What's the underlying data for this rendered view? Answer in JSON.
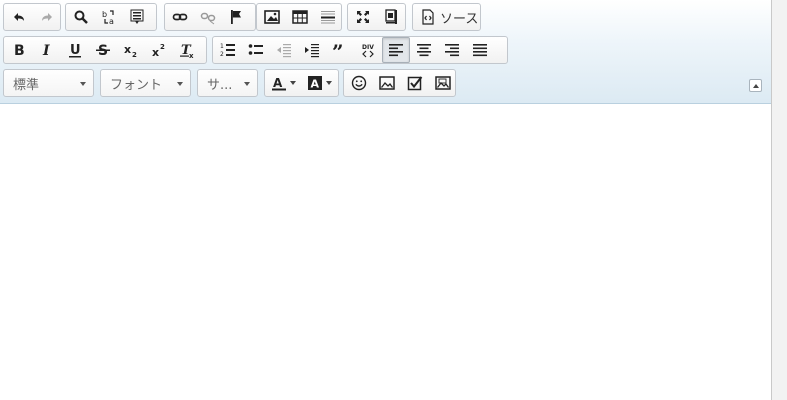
{
  "toolbar": {
    "source_label": "ソース",
    "format_placeholder": "標準",
    "font_placeholder": "フォント",
    "size_placeholder": "サ..."
  },
  "icons": {
    "row1": [
      "undo-icon",
      "redo-icon",
      "find-icon",
      "replace-icon",
      "select-all-icon",
      "link-icon",
      "unlink-icon",
      "anchor-icon",
      "image-icon",
      "table-icon",
      "horizontal-rule-icon",
      "maximize-icon",
      "show-blocks-icon",
      "source-icon"
    ],
    "row2": [
      "bold-icon",
      "italic-icon",
      "underline-icon",
      "strikethrough-icon",
      "subscript-icon",
      "superscript-icon",
      "remove-format-icon",
      "numbered-list-icon",
      "bulleted-list-icon",
      "outdent-icon",
      "indent-icon",
      "blockquote-icon",
      "div-container-icon",
      "align-left-icon",
      "align-center-icon",
      "align-right-icon",
      "justify-icon"
    ],
    "row3": [
      "text-color-icon",
      "background-color-icon",
      "smiley-icon",
      "image2-icon",
      "checkbox-icon",
      "image-map-icon",
      "collapse-toolbar-icon"
    ]
  },
  "state": {
    "active_alignment": "left"
  }
}
